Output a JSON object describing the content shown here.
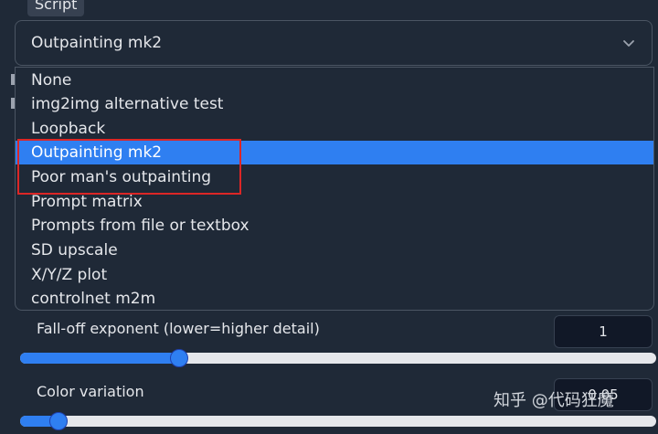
{
  "script_section": {
    "label": "Script",
    "selected_value": "Outpainting mk2"
  },
  "dropdown": {
    "options": [
      "None",
      "img2img alternative test",
      "Loopback",
      "Outpainting mk2",
      "Poor man's outpainting",
      "Prompt matrix",
      "Prompts from file or textbox",
      "SD upscale",
      "X/Y/Z plot",
      "controlnet m2m"
    ],
    "selected_index": 3
  },
  "settings": {
    "falloff": {
      "label": "Fall-off exponent (lower=higher detail)",
      "value": "1",
      "slider_fraction": 0.25
    },
    "color_variation": {
      "label": "Color variation",
      "value": "0.05",
      "slider_fraction": 0.06
    }
  },
  "watermark": "知乎 @代码狂魔",
  "colors": {
    "accent": "#2f7ff1",
    "annotation": "#dc2626"
  }
}
